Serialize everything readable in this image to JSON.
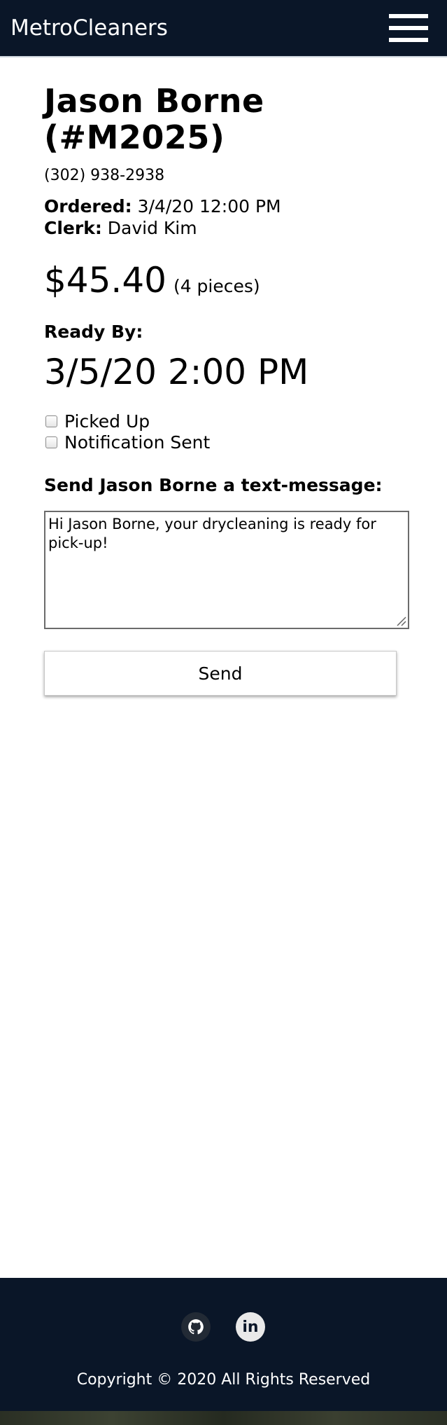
{
  "navbar": {
    "brand": "MetroCleaners",
    "menu_icon": "hamburger-menu-icon"
  },
  "order": {
    "name": "Jason Borne",
    "number": "(#M2025)",
    "phone": "(302) 938-2938",
    "ordered_label": "Ordered:",
    "ordered_value": "3/4/20 12:00 PM",
    "clerk_label": "Clerk:",
    "clerk_value": "David Kim",
    "price": "$45.40",
    "pieces": "(4 pieces)",
    "ready_label": "Ready By:",
    "ready_value": "3/5/20 2:00 PM"
  },
  "status": {
    "picked_up_label": "Picked Up",
    "picked_up_checked": false,
    "notification_label": "Notification Sent",
    "notification_checked": false
  },
  "message": {
    "label": "Send Jason Borne a text-message:",
    "text": "Hi Jason Borne, your drycleaning is ready for pick-up!",
    "send_label": "Send"
  },
  "footer": {
    "icons": [
      "github-icon",
      "linkedin-icon"
    ],
    "linkedin_text": "in",
    "copyright": "Copyright © 2020 All Rights Reserved"
  },
  "colors": {
    "navbar_bg": "#0a1628",
    "text": "#000000",
    "footer_text": "#ffffff"
  }
}
